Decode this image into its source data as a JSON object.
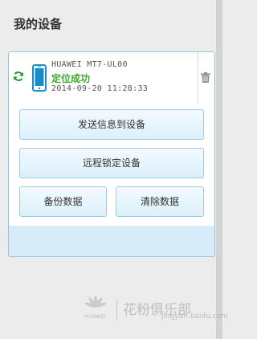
{
  "page": {
    "title": "我的设备"
  },
  "device": {
    "model": "HUAWEI MT7-UL00",
    "status": "定位成功",
    "timestamp": "2014-09-20 11:28:33",
    "icons": {
      "refresh": "refresh-icon",
      "phone": "phone-icon",
      "delete": "trash-icon"
    }
  },
  "actions": {
    "send_message": "发送信息到设备",
    "remote_lock": "远程锁定设备",
    "backup": "备份数据",
    "wipe": "清除数据"
  },
  "watermark": {
    "brand": "HUAWEI",
    "text": "花粉俱乐部",
    "url": "jingyan.baidu.com"
  },
  "colors": {
    "status_green": "#41a829",
    "accent_blue": "#1a8ccc",
    "card_border": "#8fc3df",
    "card_footer": "#d7ecf8"
  }
}
